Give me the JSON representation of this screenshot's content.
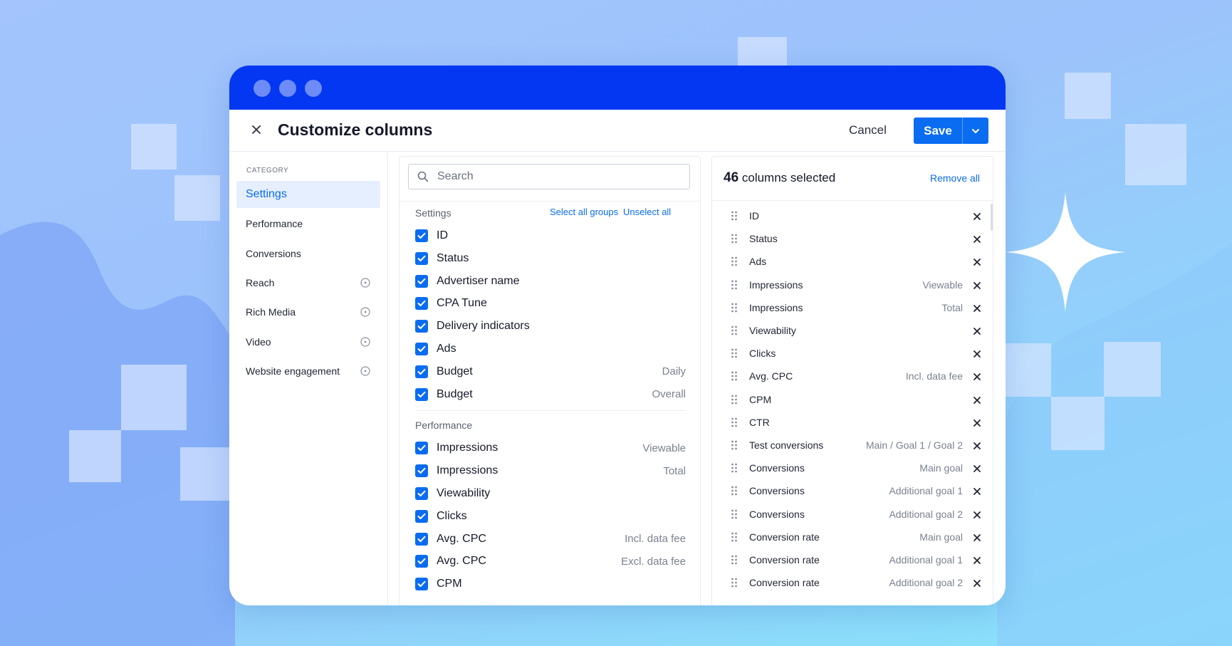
{
  "colors": {
    "titlebar": "#0437f2",
    "accent": "#0a6cf1",
    "checkbox": "#0a6cf1",
    "sidebar_active_bg": "#e6efff"
  },
  "dialog": {
    "title": "Customize columns",
    "close_icon": "close-icon",
    "cancel_label": "Cancel",
    "save_label": "Save",
    "save_menu_icon": "chevron-down-icon"
  },
  "sidebar": {
    "category_label": "CATEGORY",
    "items": [
      {
        "label": "Settings",
        "active": true,
        "info": false
      },
      {
        "label": "Performance",
        "active": false,
        "info": false
      },
      {
        "label": "Conversions",
        "active": false,
        "info": false
      },
      {
        "label": "Reach",
        "active": false,
        "info": true
      },
      {
        "label": "Rich Media",
        "active": false,
        "info": true
      },
      {
        "label": "Video",
        "active": false,
        "info": true
      },
      {
        "label": "Website engagement",
        "active": false,
        "info": true
      }
    ]
  },
  "available": {
    "search_placeholder": "Search",
    "select_all_label": "Select all groups",
    "unselect_all_label": "Unselect all",
    "groups": [
      {
        "title": "Settings",
        "options": [
          {
            "label": "ID",
            "variant": "",
            "checked": true
          },
          {
            "label": "Status",
            "variant": "",
            "checked": true
          },
          {
            "label": "Advertiser name",
            "variant": "",
            "checked": true
          },
          {
            "label": "CPA Tune",
            "variant": "",
            "checked": true
          },
          {
            "label": "Delivery indicators",
            "variant": "",
            "checked": true
          },
          {
            "label": "Ads",
            "variant": "",
            "checked": true
          },
          {
            "label": "Budget",
            "variant": "Daily",
            "checked": true
          },
          {
            "label": "Budget",
            "variant": "Overall",
            "checked": true
          }
        ]
      },
      {
        "title": "Performance",
        "options": [
          {
            "label": "Impressions",
            "variant": "Viewable",
            "checked": true
          },
          {
            "label": "Impressions",
            "variant": "Total",
            "checked": true
          },
          {
            "label": "Viewability",
            "variant": "",
            "checked": true
          },
          {
            "label": "Clicks",
            "variant": "",
            "checked": true
          },
          {
            "label": "Avg. CPC",
            "variant": "Incl. data fee",
            "checked": true
          },
          {
            "label": "Avg. CPC",
            "variant": "Excl. data fee",
            "checked": true
          },
          {
            "label": "CPM",
            "variant": "",
            "checked": true
          }
        ]
      }
    ]
  },
  "selected": {
    "count": "46",
    "count_suffix": "columns selected",
    "remove_all_label": "Remove all",
    "items": [
      {
        "label": "ID",
        "variant": ""
      },
      {
        "label": "Status",
        "variant": ""
      },
      {
        "label": "Ads",
        "variant": ""
      },
      {
        "label": "Impressions",
        "variant": "Viewable"
      },
      {
        "label": "Impressions",
        "variant": "Total"
      },
      {
        "label": "Viewability",
        "variant": ""
      },
      {
        "label": "Clicks",
        "variant": ""
      },
      {
        "label": "Avg. CPC",
        "variant": "Incl. data fee"
      },
      {
        "label": "CPM",
        "variant": ""
      },
      {
        "label": "CTR",
        "variant": ""
      },
      {
        "label": "Test conversions",
        "variant": "Main / Goal 1 / Goal 2"
      },
      {
        "label": "Conversions",
        "variant": "Main goal"
      },
      {
        "label": "Conversions",
        "variant": "Additional goal 1"
      },
      {
        "label": "Conversions",
        "variant": "Additional goal 2"
      },
      {
        "label": "Conversion rate",
        "variant": "Main goal"
      },
      {
        "label": "Conversion rate",
        "variant": "Additional goal 1"
      },
      {
        "label": "Conversion rate",
        "variant": "Additional goal 2"
      }
    ]
  }
}
